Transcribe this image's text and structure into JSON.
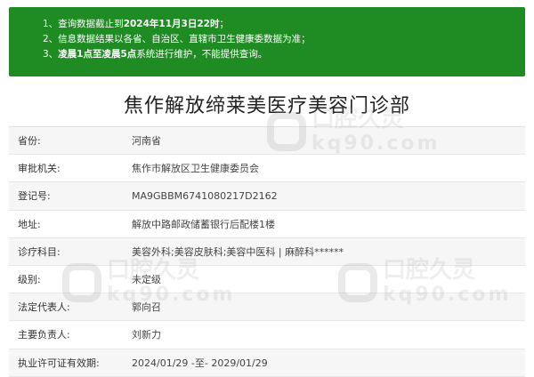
{
  "notice": {
    "line1": {
      "pre": "1、查询数据截止到",
      "bold": "2024年11月3日22时",
      "post": "；"
    },
    "line2": {
      "text": "2、信息数据结果以各省、自治区、直辖市卫生健康委数据为准；"
    },
    "line3": {
      "pre": "3、",
      "bold": "凌晨1点至凌晨5点",
      "post": "系统进行维护，不能提供查询。"
    }
  },
  "title": "焦作解放缔莱美医疗美容门诊部",
  "rows": [
    {
      "label": "省份:",
      "value": "河南省"
    },
    {
      "label": "审批机关:",
      "value": "焦作市解放区卫生健康委员会"
    },
    {
      "label": "登记号:",
      "value": "MA9GBBM6741080217D2162"
    },
    {
      "label": "地址:",
      "value": "解放中路邮政储蓄银行后配楼1楼"
    },
    {
      "label": "诊疗科目:",
      "value": "美容外科;美容皮肤科;美容中医科 | 麻醉科******"
    },
    {
      "label": "级别:",
      "value": "未定级"
    },
    {
      "label": "法定代表人:",
      "value": "郭向召"
    },
    {
      "label": "主要负责人:",
      "value": "刘新力"
    },
    {
      "label": "执业许可证有效期:",
      "value": "2024/01/29 -至- 2029/01/29"
    }
  ],
  "watermark": {
    "text": "口腔久灵",
    "sub": "kq90.com"
  },
  "colors": {
    "notice_bg": "#1e8c22",
    "row_alt": "#f6f6f6"
  }
}
